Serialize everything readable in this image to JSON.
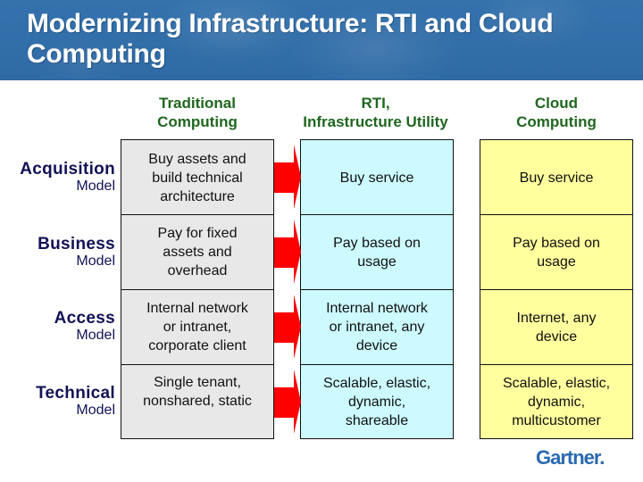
{
  "slide": {
    "title": "Modernizing Infrastructure: RTI and Cloud Computing",
    "colors": {
      "banner": "#2f6aa5",
      "column_header_text": "#1f661f",
      "row_label_text": "#121256",
      "traditional_fill": "#e8e8e8",
      "rti_fill": "#ccfaff",
      "cloud_fill": "#ffff9e",
      "arrow": "#ff0000",
      "logo": "#2a6aae"
    }
  },
  "columns": [
    {
      "id": "traditional",
      "header": "Traditional\nComputing"
    },
    {
      "id": "rti",
      "header": "RTI,\nInfrastructure Utility"
    },
    {
      "id": "cloud",
      "header": "Cloud\nComputing"
    }
  ],
  "rows": [
    {
      "label": "Acquisition",
      "sublabel": "Model",
      "traditional": "Buy assets and\nbuild technical\narchitecture",
      "rti": "Buy service",
      "cloud": "Buy service"
    },
    {
      "label": "Business",
      "sublabel": "Model",
      "traditional": "Pay for fixed\nassets and\noverhead",
      "rti": "Pay based on\nusage",
      "cloud": "Pay based on\nusage"
    },
    {
      "label": "Access",
      "sublabel": "Model",
      "traditional": "Internal network\nor intranet,\ncorporate client",
      "rti": "Internal network\nor intranet, any\ndevice",
      "cloud": "Internet, any\ndevice"
    },
    {
      "label": "Technical",
      "sublabel": "Model",
      "traditional": "Single tenant,\nnonshared, static",
      "rti": "Scalable, elastic,\ndynamic,\nshareable",
      "cloud": "Scalable, elastic,\ndynamic,\nmulticustomer"
    }
  ],
  "arrows": {
    "icon": "right-arrow-icon",
    "count": 4
  },
  "footer": {
    "logo_text": "Gartner."
  }
}
